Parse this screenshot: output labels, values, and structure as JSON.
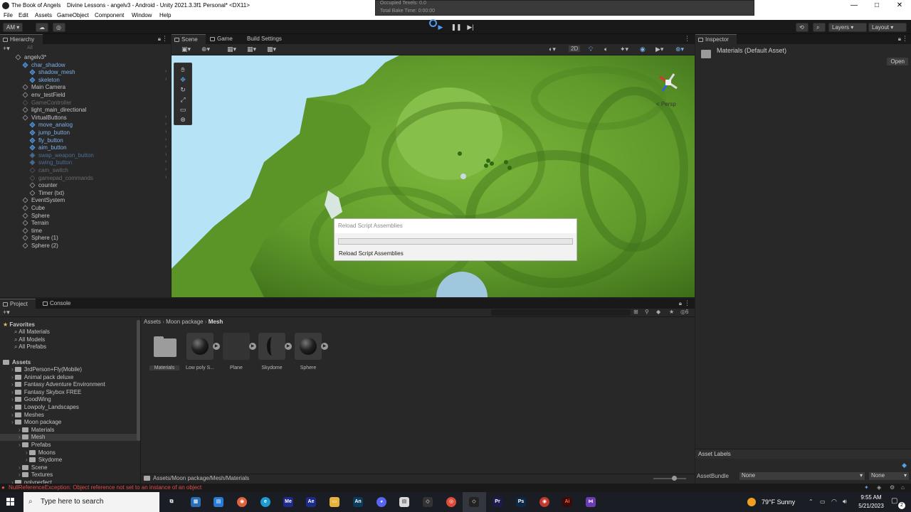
{
  "window": {
    "title_app": "The Book of Angels",
    "title_doc": "Divine Lessons - angelv3 - Android - Unity 2021.3.3f1 Personal* <DX11>",
    "minimize": "—",
    "maximize": "□",
    "close": "✕"
  },
  "menu": [
    "File",
    "Edit",
    "Assets",
    "GameObject",
    "Component",
    "Window",
    "Help"
  ],
  "bake": {
    "occupied": "Occupied Texels: 0.0",
    "total": "Total Bake Time: 0:00:00"
  },
  "toolbar": {
    "account": "AM ▾",
    "layers": "Layers",
    "layout": "Layout"
  },
  "hierarchy": {
    "tab": "Hierarchy",
    "search_placeholder": "All",
    "items": [
      {
        "label": "angelv3*",
        "indent": 0,
        "style": "scene"
      },
      {
        "label": "char_shadow",
        "indent": 1,
        "style": "blue"
      },
      {
        "label": "shadow_mesh",
        "indent": 2,
        "style": "blue"
      },
      {
        "label": "skeleton",
        "indent": 2,
        "style": "blue"
      },
      {
        "label": "Main Camera",
        "indent": 1,
        "style": ""
      },
      {
        "label": "env_testField",
        "indent": 1,
        "style": ""
      },
      {
        "label": "GameController",
        "indent": 1,
        "style": "dim"
      },
      {
        "label": "light_main_directional",
        "indent": 1,
        "style": ""
      },
      {
        "label": "VirtualButtons",
        "indent": 1,
        "style": ""
      },
      {
        "label": "move_analog",
        "indent": 2,
        "style": "blue"
      },
      {
        "label": "jump_button",
        "indent": 2,
        "style": "blue"
      },
      {
        "label": "fly_button",
        "indent": 2,
        "style": "blue"
      },
      {
        "label": "aim_button",
        "indent": 2,
        "style": "blue"
      },
      {
        "label": "swap_weapon_button",
        "indent": 2,
        "style": "dimblue"
      },
      {
        "label": "swing_button",
        "indent": 2,
        "style": "dimblue"
      },
      {
        "label": "cam_switch",
        "indent": 2,
        "style": "dim"
      },
      {
        "label": "gamepad_commands",
        "indent": 2,
        "style": "dim"
      },
      {
        "label": "counter",
        "indent": 2,
        "style": ""
      },
      {
        "label": "Timer (txt)",
        "indent": 2,
        "style": ""
      },
      {
        "label": "EventSystem",
        "indent": 1,
        "style": ""
      },
      {
        "label": "Cube",
        "indent": 1,
        "style": ""
      },
      {
        "label": "Sphere",
        "indent": 1,
        "style": ""
      },
      {
        "label": "Terrain",
        "indent": 1,
        "style": ""
      },
      {
        "label": "time",
        "indent": 1,
        "style": ""
      },
      {
        "label": "Sphere (1)",
        "indent": 1,
        "style": ""
      },
      {
        "label": "Sphere (2)",
        "indent": 1,
        "style": ""
      }
    ]
  },
  "scene": {
    "tabs": [
      "Scene",
      "Game",
      "Build Settings"
    ],
    "mode_2d": "2D",
    "persp": "< Persp"
  },
  "dialog": {
    "title": "Reload Script Assemblies",
    "message": "Reload Script Assemblies",
    "progress": 0
  },
  "inspector": {
    "tab": "Inspector",
    "asset_name": "Materials (Default Asset)",
    "open": "Open",
    "asset_labels": "Asset Labels",
    "asset_bundle_label": "AssetBundle",
    "asset_bundle_value": "None",
    "asset_bundle_variant": "None"
  },
  "project": {
    "tabs": [
      "Project",
      "Console"
    ],
    "breadcrumb": [
      "Assets",
      "Moon package",
      "Mesh"
    ],
    "favorites_title": "Favorites",
    "favorites": [
      "All Materials",
      "All Models",
      "All Prefabs"
    ],
    "assets_title": "Assets",
    "tree": [
      {
        "label": "3rdPerson+Fly(Mobile)",
        "indent": 1
      },
      {
        "label": "Animal pack deluxe",
        "indent": 1
      },
      {
        "label": "Fantasy Adventure Environment",
        "indent": 1
      },
      {
        "label": "Fantasy Skybox FREE",
        "indent": 1
      },
      {
        "label": "GoodWing",
        "indent": 1
      },
      {
        "label": "Lowpoly_Landscapes",
        "indent": 1
      },
      {
        "label": "Meshes",
        "indent": 1
      },
      {
        "label": "Moon package",
        "indent": 1
      },
      {
        "label": "Materials",
        "indent": 2
      },
      {
        "label": "Mesh",
        "indent": 2
      },
      {
        "label": "Prefabs",
        "indent": 2
      },
      {
        "label": "Moons",
        "indent": 3
      },
      {
        "label": "Skydome",
        "indent": 3
      },
      {
        "label": "Scene",
        "indent": 2
      },
      {
        "label": "Textures",
        "indent": 2
      },
      {
        "label": "polyperfect",
        "indent": 1
      }
    ],
    "assets": [
      {
        "label": "Materials",
        "kind": "folder"
      },
      {
        "label": "Low poly S...",
        "kind": "sphere"
      },
      {
        "label": "Plane",
        "kind": "plane"
      },
      {
        "label": "Skydome",
        "kind": "dome"
      },
      {
        "label": "Sphere",
        "kind": "sphere"
      }
    ],
    "path": "Assets/Moon package/Mesh/Materials",
    "badge": "6"
  },
  "status": {
    "error": "NullReferenceException: Object reference not set to an instance of an object"
  },
  "taskbar": {
    "search_placeholder": "Type here to search",
    "weather": "79°F  Sunny",
    "time": "9:55 AM",
    "date": "5/21/2023",
    "notif": "2"
  },
  "colors": {
    "sky": "#b6e3f5",
    "terrain": "#6aa532",
    "error": "#e04c4c",
    "selection_blue": "#7fb0ea"
  }
}
